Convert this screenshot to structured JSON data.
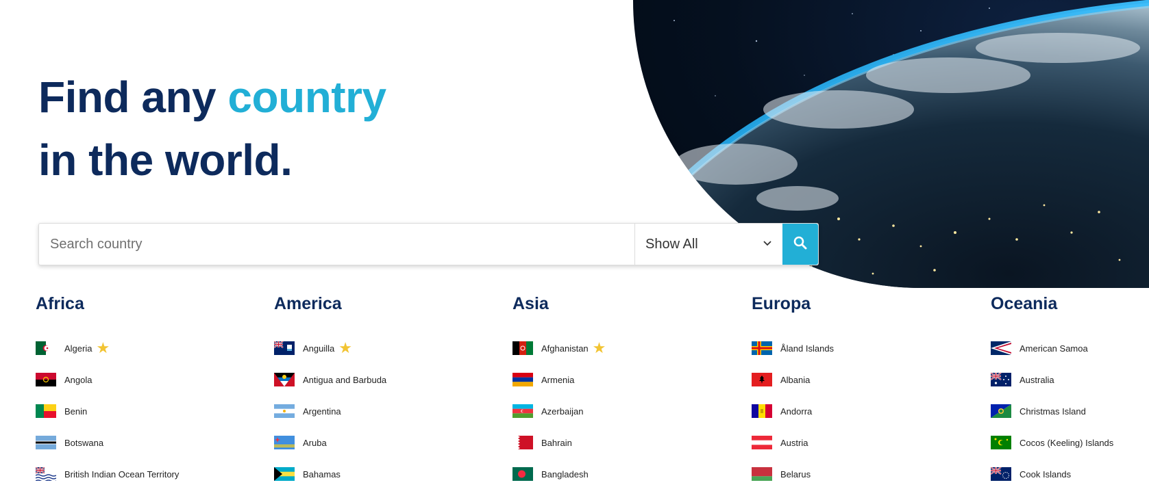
{
  "hero": {
    "headline_part1": "Find any ",
    "headline_accent": "country",
    "headline_part2": "in the world."
  },
  "search": {
    "placeholder": "Search country",
    "filter_selected": "Show All"
  },
  "colors": {
    "primary": "#0d2a5c",
    "accent": "#22afd6",
    "favorite_star": "#f2c433"
  },
  "continents": [
    {
      "name": "Africa",
      "countries": [
        {
          "name": "Algeria",
          "favorite": true
        },
        {
          "name": "Angola",
          "favorite": false
        },
        {
          "name": "Benin",
          "favorite": false
        },
        {
          "name": "Botswana",
          "favorite": false
        },
        {
          "name": "British Indian Ocean Territory",
          "favorite": false
        }
      ]
    },
    {
      "name": "America",
      "countries": [
        {
          "name": "Anguilla",
          "favorite": true
        },
        {
          "name": "Antigua and Barbuda",
          "favorite": false
        },
        {
          "name": "Argentina",
          "favorite": false
        },
        {
          "name": "Aruba",
          "favorite": false
        },
        {
          "name": "Bahamas",
          "favorite": false
        }
      ]
    },
    {
      "name": "Asia",
      "countries": [
        {
          "name": "Afghanistan",
          "favorite": true
        },
        {
          "name": "Armenia",
          "favorite": false
        },
        {
          "name": "Azerbaijan",
          "favorite": false
        },
        {
          "name": "Bahrain",
          "favorite": false
        },
        {
          "name": "Bangladesh",
          "favorite": false
        }
      ]
    },
    {
      "name": "Europa",
      "countries": [
        {
          "name": "Åland Islands",
          "favorite": false
        },
        {
          "name": "Albania",
          "favorite": false
        },
        {
          "name": "Andorra",
          "favorite": false
        },
        {
          "name": "Austria",
          "favorite": false
        },
        {
          "name": "Belarus",
          "favorite": false
        }
      ]
    },
    {
      "name": "Oceania",
      "countries": [
        {
          "name": "American Samoa",
          "favorite": false
        },
        {
          "name": "Australia",
          "favorite": false
        },
        {
          "name": "Christmas Island",
          "favorite": false
        },
        {
          "name": "Cocos (Keeling) Islands",
          "favorite": false
        },
        {
          "name": "Cook Islands",
          "favorite": false
        }
      ]
    }
  ]
}
